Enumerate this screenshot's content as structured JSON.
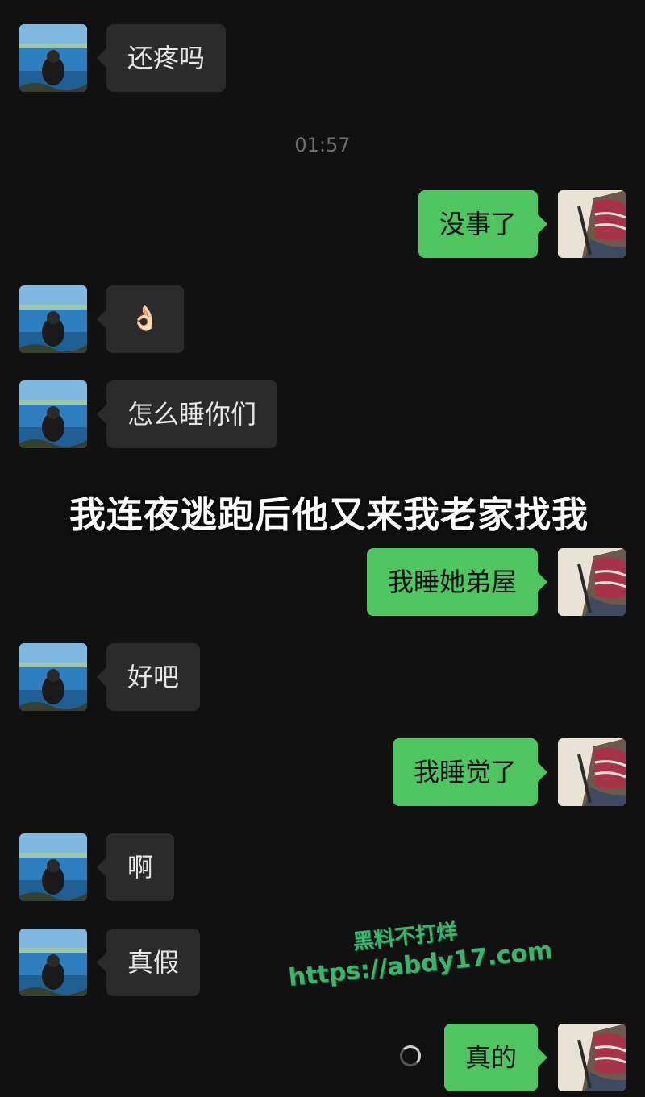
{
  "chat": {
    "timestamp": "01:57",
    "messages": [
      {
        "side": "in",
        "text": "还疼吗"
      },
      {
        "side": "out",
        "text": "没事了"
      },
      {
        "side": "in",
        "text": "👌🏻"
      },
      {
        "side": "in",
        "text": "怎么睡你们"
      },
      {
        "side": "out",
        "text": "我睡她弟屋"
      },
      {
        "side": "in",
        "text": "好吧"
      },
      {
        "side": "out",
        "text": "我睡觉了"
      },
      {
        "side": "in",
        "text": "啊"
      },
      {
        "side": "in",
        "text": "真假"
      },
      {
        "side": "out",
        "text": "真的"
      }
    ]
  },
  "overlay": {
    "caption": "我连夜逃跑后他又来我老家找我",
    "watermark_name": "黑料不打烊",
    "watermark_url": "https://abdy17.com"
  },
  "avatars": {
    "contact": "lake-avatar",
    "self": "butterfly-avatar"
  },
  "colors": {
    "background": "#111111",
    "incoming_bubble": "#2b2b2b",
    "outgoing_bubble": "#4fc562",
    "watermark": "#3bb56d"
  }
}
